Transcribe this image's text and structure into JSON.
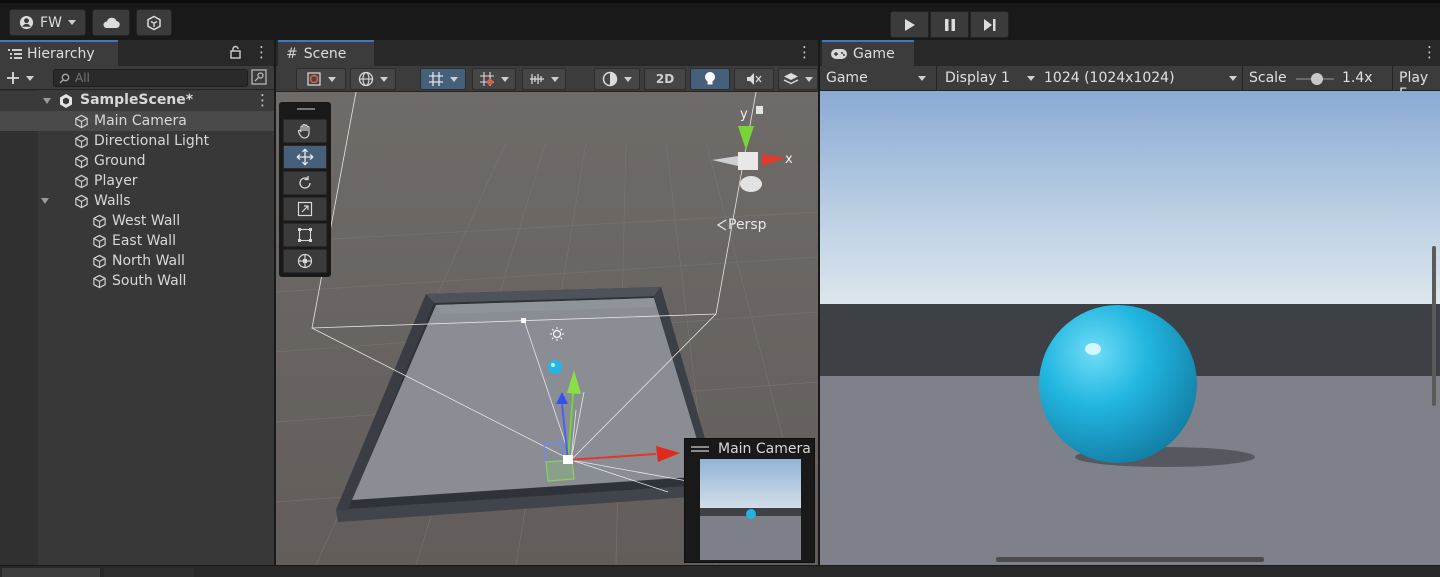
{
  "toolbar": {
    "account_label": "FW",
    "play_icon": "play-icon",
    "pause_icon": "pause-icon",
    "step_icon": "step-icon"
  },
  "hierarchy": {
    "tab_label": "Hierarchy",
    "search_placeholder": "All",
    "scene_name": "SampleScene*",
    "items": [
      {
        "label": "Main Camera",
        "depth": 1,
        "selected": true
      },
      {
        "label": "Directional Light",
        "depth": 1
      },
      {
        "label": "Ground",
        "depth": 1
      },
      {
        "label": "Player",
        "depth": 1
      },
      {
        "label": "Walls",
        "depth": 1,
        "expanded": true
      },
      {
        "label": "West Wall",
        "depth": 2
      },
      {
        "label": "East Wall",
        "depth": 2
      },
      {
        "label": "North Wall",
        "depth": 2
      },
      {
        "label": "South Wall",
        "depth": 2
      }
    ]
  },
  "scene": {
    "tab_label": "Scene",
    "mode_2d": "2D",
    "persp_label": "Persp",
    "gizmo_y": "y",
    "gizmo_x": "x",
    "camera_preview_title": "Main Camera"
  },
  "game": {
    "tab_label": "Game",
    "view_select": "Game",
    "display_select": "Display 1",
    "resolution_select": "1024 (1024x1024)",
    "scale_label": "Scale",
    "scale_value": "1.4x",
    "play_mode_label": "Play F",
    "scale_slider_fraction": 0.4
  },
  "colors": {
    "accent": "#3a79bb",
    "sphere": "#1fb6e0",
    "sky_top": "#8fb0d6",
    "ground": "#7d8088"
  }
}
